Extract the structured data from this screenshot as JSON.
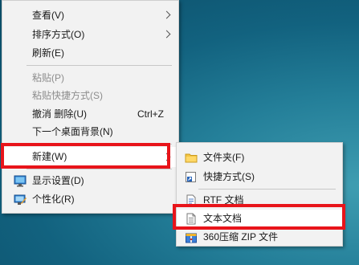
{
  "context_menu": {
    "items": [
      {
        "label": "查看(V)",
        "has_submenu": true
      },
      {
        "label": "排序方式(O)",
        "has_submenu": true
      },
      {
        "label": "刷新(E)"
      },
      {
        "label": "粘贴(P)",
        "disabled": true
      },
      {
        "label": "粘贴快捷方式(S)",
        "disabled": true
      },
      {
        "label": "撤消 删除(U)",
        "shortcut": "Ctrl+Z"
      },
      {
        "label": "下一个桌面背景(N)"
      },
      {
        "label": "新建(W)",
        "has_submenu": true,
        "highlighted": true
      },
      {
        "label": "显示设置(D)",
        "icon": "display-settings-icon"
      },
      {
        "label": "个性化(R)",
        "icon": "personalize-icon"
      }
    ]
  },
  "new_submenu": {
    "items": [
      {
        "label": "文件夹(F)",
        "icon": "folder-icon"
      },
      {
        "label": "快捷方式(S)",
        "icon": "shortcut-icon"
      },
      {
        "label": "RTF 文档",
        "icon": "rtf-document-icon"
      },
      {
        "label": "文本文档",
        "icon": "text-document-icon",
        "highlighted": true
      },
      {
        "label": "360压缩 ZIP 文件",
        "icon": "zip-archive-icon"
      }
    ]
  },
  "colors": {
    "annotation_red": "#e8141a",
    "menu_background": "#f2f2f2",
    "desktop_background": "#1b6e8a"
  }
}
